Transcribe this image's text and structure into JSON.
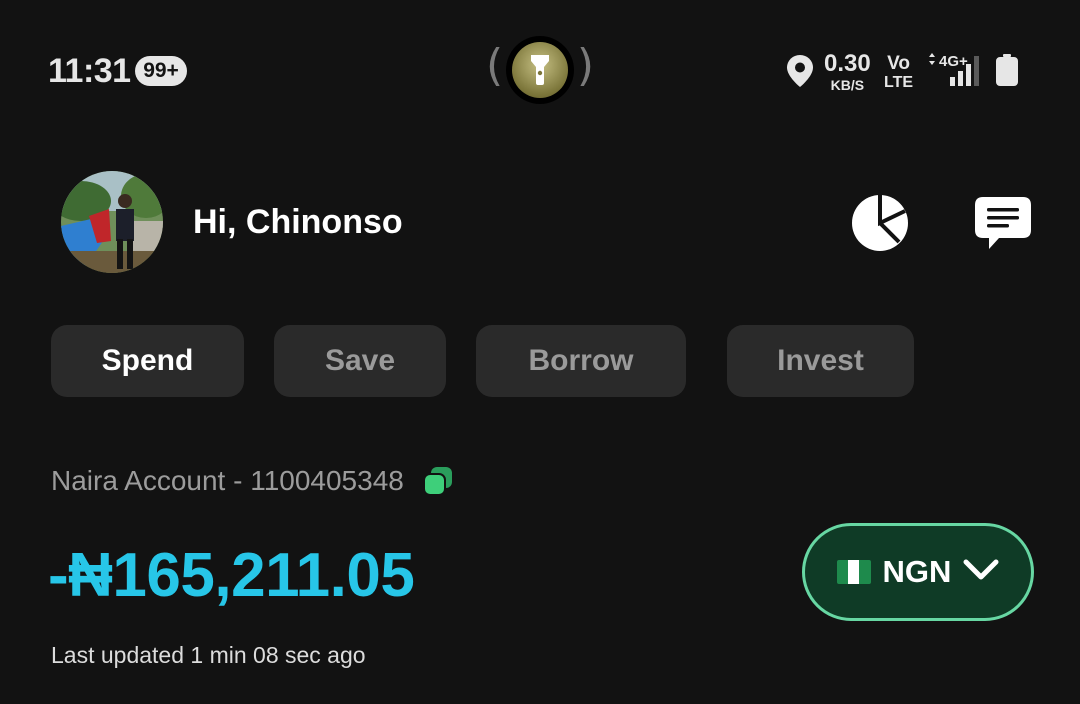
{
  "status_bar": {
    "time": "11:31",
    "notification_count": "99+",
    "net_speed_value": "0.30",
    "net_speed_unit": "KB/S",
    "volte_top": "Vo",
    "volte_bottom": "LTE",
    "network_type": "4G+"
  },
  "header": {
    "greeting": "Hi, Chinonso"
  },
  "tabs": [
    {
      "label": "Spend",
      "active": true
    },
    {
      "label": "Save",
      "active": false
    },
    {
      "label": "Borrow",
      "active": false
    },
    {
      "label": "Invest",
      "active": false
    }
  ],
  "account": {
    "label": "Naira Account - 1100405348",
    "balance": "-₦165,211.05",
    "last_updated": "Last updated 1 min 08 sec ago",
    "currency_code": "NGN"
  },
  "colors": {
    "background": "#121212",
    "balance": "#27c6e8",
    "currency_border": "#67d7a3",
    "currency_bg": "#0f3b26",
    "copy_icon": "#3ecf7a"
  },
  "icons": [
    "location-icon",
    "signal-icon",
    "battery-icon",
    "flashlight-icon",
    "pie-chart-icon",
    "chat-icon",
    "copy-icon",
    "nigeria-flag-icon",
    "chevron-down-icon"
  ]
}
